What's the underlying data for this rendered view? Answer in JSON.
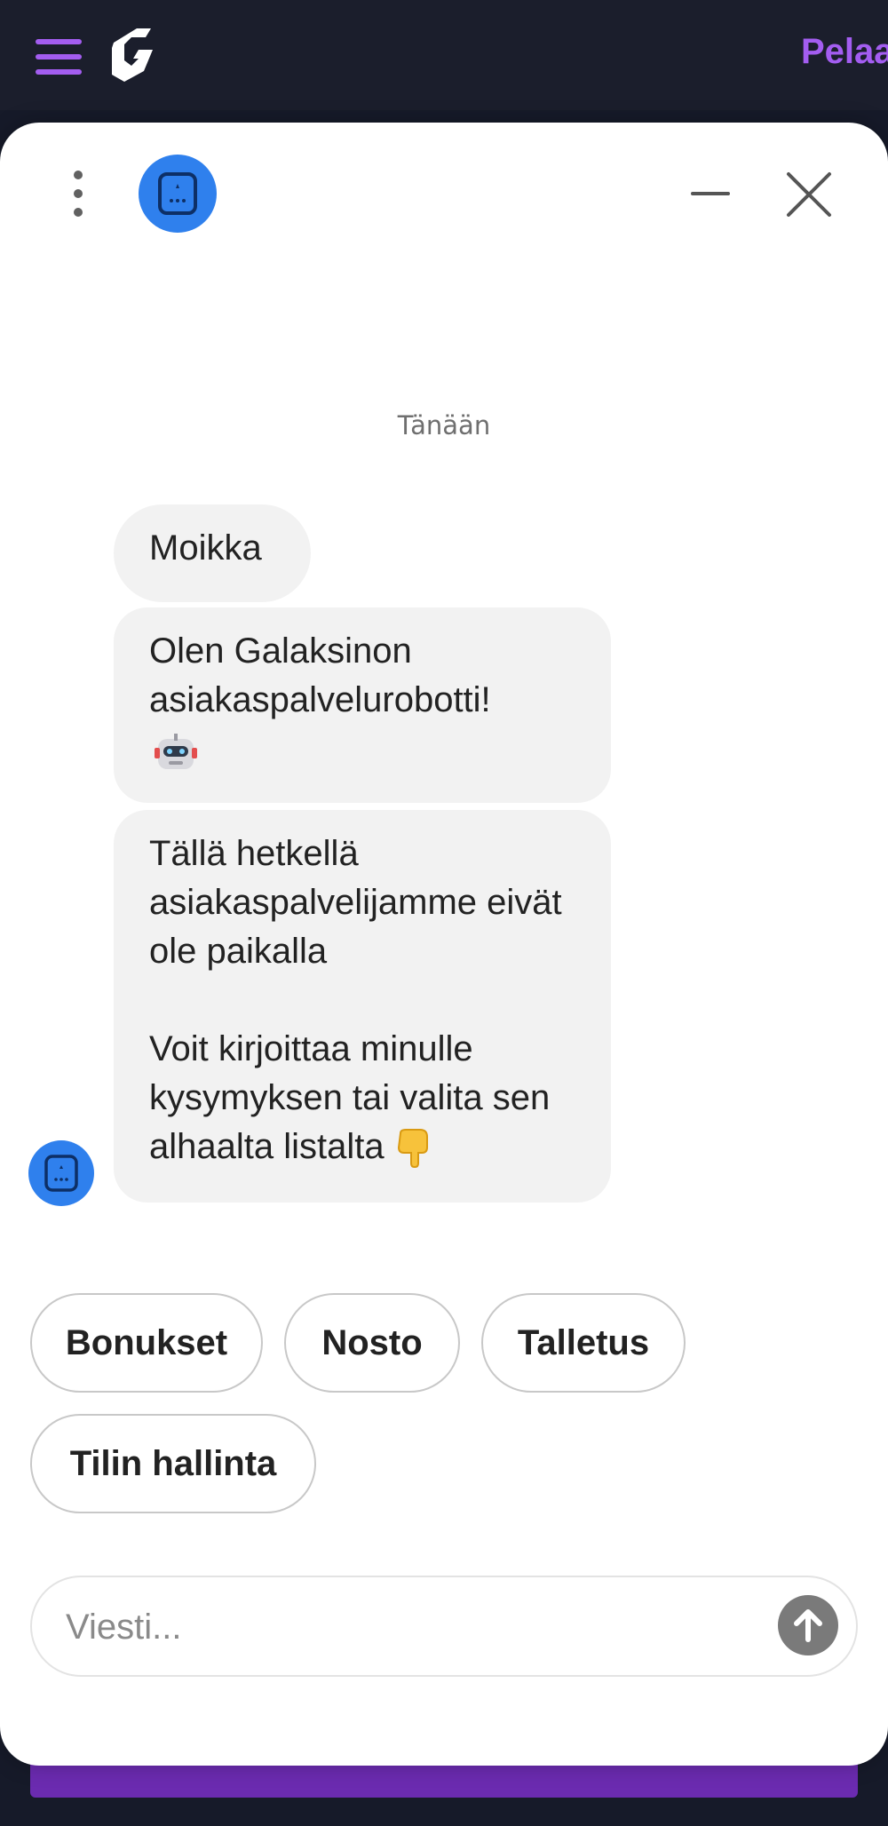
{
  "site": {
    "play_link": "Pelaa",
    "brand_color": "#a35df0"
  },
  "chat": {
    "date_divider": "Tänään",
    "messages": [
      {
        "sender": "bot",
        "text": "Moikka"
      },
      {
        "sender": "bot",
        "text": "Olen Galaksinon asiakaspalvelurobotti!",
        "emoji": "robot-face"
      },
      {
        "sender": "bot",
        "text": "Tällä hetkellä asiakaspalvelijamme eivät ole paikalla\n\nVoit kirjoittaa minulle kysymyksen tai valita sen alhaalta listalta",
        "emoji": "backhand-index-pointing-down"
      }
    ],
    "quick_replies": [
      "Bonukset",
      "Nosto",
      "Talletus",
      "Tilin hallinta"
    ],
    "composer": {
      "placeholder": "Viesti...",
      "value": ""
    },
    "avatar_color": "#2f80ed"
  }
}
